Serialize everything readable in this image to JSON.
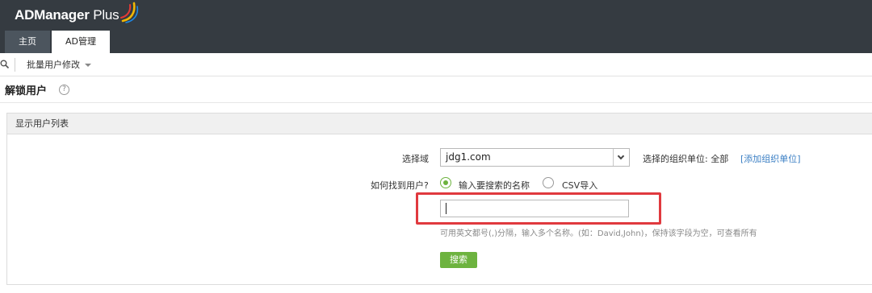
{
  "app": {
    "logo_main": "ADManager",
    "logo_suffix": " Plus",
    "tabs": [
      {
        "label": "主页",
        "active": false
      },
      {
        "label": "AD管理",
        "active": true
      }
    ]
  },
  "toolbar": {
    "menu_label": "批量用户修改"
  },
  "page": {
    "title": "解锁用户",
    "help": "?"
  },
  "panel": {
    "header": "显示用户列表",
    "domain_label": "选择域",
    "domain_value": "jdg1.com",
    "ou_label": "选择的组织单位: 全部",
    "ou_link": "[添加组织单位]",
    "find_label": "如何找到用户?",
    "options": [
      {
        "label": "输入要搜索的名称",
        "checked": true
      },
      {
        "label": "CSV导入",
        "checked": false
      }
    ],
    "name_input_value": "",
    "hint": "可用英文都号(,)分隔，输入多个名称。(如：David,John)，保持该字段为空，可查看所有",
    "search_button": "搜索"
  },
  "colors": {
    "header_bg": "#353b41",
    "accent_green": "#6db33f",
    "link_blue": "#3b7fc4",
    "highlight_red": "#e0393e"
  }
}
